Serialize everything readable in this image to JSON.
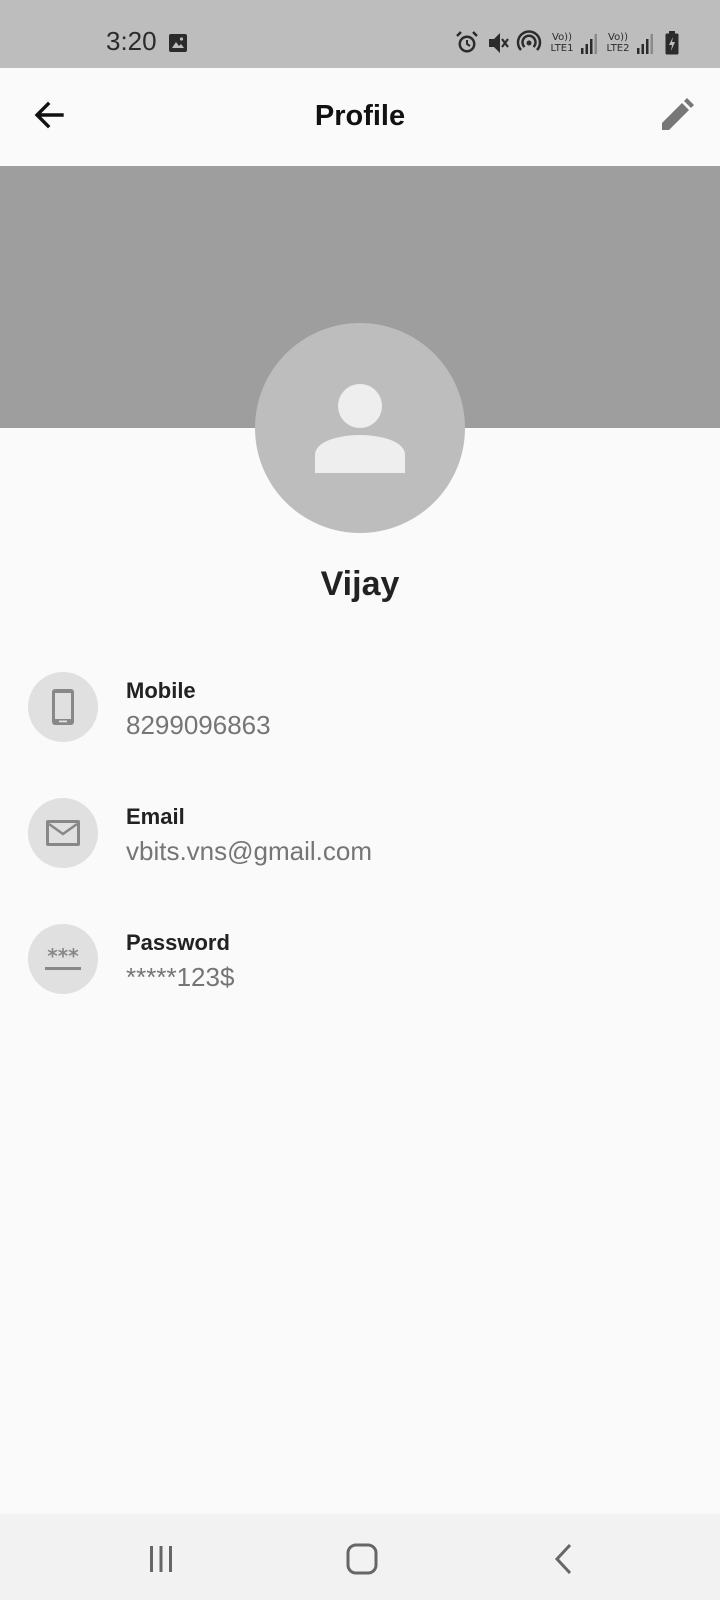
{
  "status_bar": {
    "time": "3:20",
    "sim1_label": "LTE1",
    "sim2_label": "LTE2",
    "volte_label": "Vo))",
    "icons": [
      "image-icon",
      "alarm-icon",
      "mute-icon",
      "hotspot-icon",
      "signal-icon",
      "signal-icon",
      "battery-charging-icon"
    ]
  },
  "app_bar": {
    "title": "Profile",
    "back_icon": "arrow-back-icon",
    "edit_icon": "pencil-icon"
  },
  "profile": {
    "name": "Vijay",
    "avatar_icon": "person-icon"
  },
  "details": [
    {
      "label": "Mobile",
      "value": "8299096863",
      "icon": "phone-icon"
    },
    {
      "label": "Email",
      "value": "vbits.vns@gmail.com",
      "icon": "mail-icon"
    },
    {
      "label": "Password",
      "value": "*****123$",
      "icon": "password-icon"
    }
  ],
  "nav_bar": {
    "icons": [
      "recents-icon",
      "home-icon",
      "back-icon"
    ]
  },
  "colors": {
    "status_bar": "#bdbdbd",
    "cover": "#9e9e9e",
    "avatar_bg": "#bdbdbd",
    "icon_circle": "#e0e0e0",
    "value_text": "#757575",
    "background": "#fafafa"
  }
}
